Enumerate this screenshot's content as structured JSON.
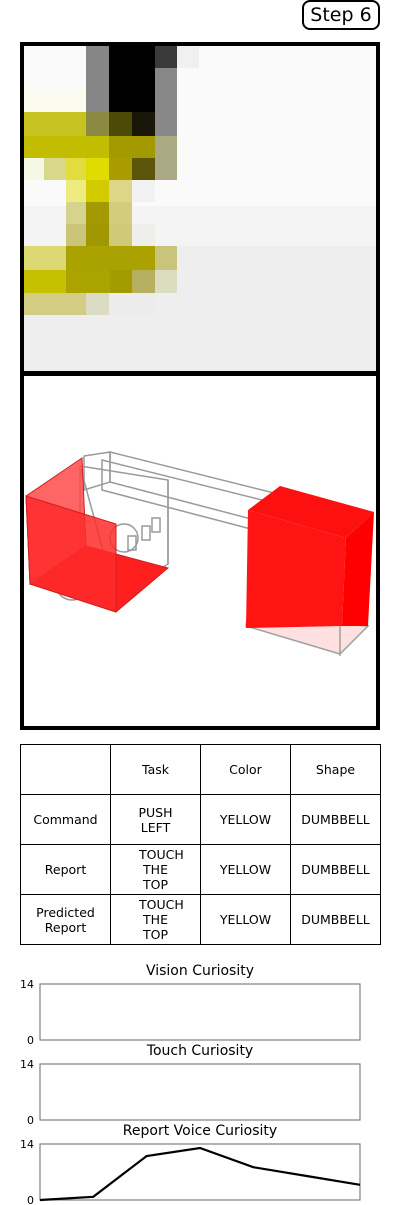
{
  "step_label": "Step 6",
  "table": {
    "headers": [
      "",
      "Task",
      "Color",
      "Shape"
    ],
    "rows": [
      {
        "label": "Command",
        "task": "PUSH LEFT",
        "color": "YELLOW",
        "shape": "DUMBBELL"
      },
      {
        "label": "Report",
        "task": "TOUCH THE TOP",
        "color": "YELLOW",
        "shape": "DUMBBELL"
      },
      {
        "label": "Predicted Report",
        "task": "TOUCH THE TOP",
        "color": "YELLOW",
        "shape": "DUMBBELL"
      }
    ]
  },
  "chart_data": [
    {
      "type": "line",
      "title": "Vision Curiosity",
      "ylim": [
        0,
        14
      ],
      "yticks": [
        0,
        14
      ],
      "x": [],
      "values": []
    },
    {
      "type": "line",
      "title": "Touch Curiosity",
      "ylim": [
        0,
        14
      ],
      "yticks": [
        0,
        14
      ],
      "x": [],
      "values": []
    },
    {
      "type": "line",
      "title": "Report Voice Curiosity",
      "ylim": [
        0,
        14
      ],
      "yticks": [
        0,
        14
      ],
      "x": [
        0,
        1,
        2,
        3,
        4,
        5,
        6
      ],
      "values": [
        0,
        0.8,
        11,
        13,
        8.2,
        6,
        3.8
      ]
    }
  ],
  "colors": {
    "scene_red": "#ff1a1a",
    "line": "#000000",
    "axis": "#808080"
  }
}
